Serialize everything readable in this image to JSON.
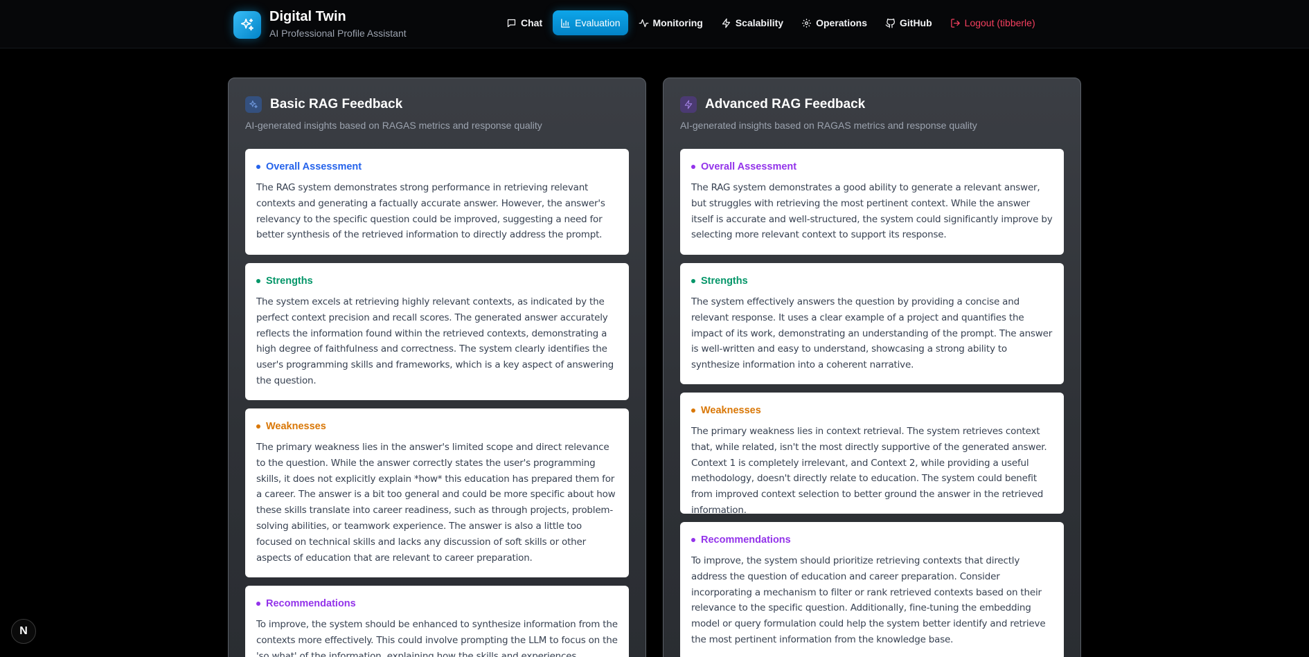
{
  "app": {
    "title": "Digital Twin",
    "subtitle": "AI Professional Profile Assistant"
  },
  "nav": {
    "chat": "Chat",
    "evaluation": "Evaluation",
    "monitoring": "Monitoring",
    "scalability": "Scalability",
    "operations": "Operations",
    "github": "GitHub",
    "logout": "Logout (tibberle)",
    "active": "evaluation"
  },
  "colors": {
    "accent": "#0ea5e9",
    "logout": "#f43f5e",
    "assessment_basic": "#2563eb",
    "assessment_advanced": "#9333ea",
    "strengths": "#059669",
    "weaknesses": "#d97706",
    "recommendations": "#9333ea"
  },
  "basic": {
    "title": "Basic RAG Feedback",
    "subtitle": "AI-generated insights based on RAGAS metrics and response quality",
    "overall": {
      "heading": "Overall Assessment",
      "body": "The RAG system demonstrates strong performance in retrieving relevant contexts and generating a factually accurate answer. However, the answer's relevancy to the specific question could be improved, suggesting a need for better synthesis of the retrieved information to directly address the prompt."
    },
    "strengths": {
      "heading": "Strengths",
      "body": "The system excels at retrieving highly relevant contexts, as indicated by the perfect context precision and recall scores. The generated answer accurately reflects the information found within the retrieved contexts, demonstrating a high degree of faithfulness and correctness. The system clearly identifies the user's programming skills and frameworks, which is a key aspect of answering the question."
    },
    "weaknesses": {
      "heading": "Weaknesses",
      "body": "The primary weakness lies in the answer's limited scope and direct relevance to the question. While the answer correctly states the user's programming skills, it does not explicitly explain *how* this education has prepared them for a career. The answer is a bit too general and could be more specific about how these skills translate into career readiness, such as through projects, problem-solving abilities, or teamwork experience. The answer is also a little too focused on technical skills and lacks any discussion of soft skills or other aspects of education that are relevant to career preparation."
    },
    "recommendations": {
      "heading": "Recommendations",
      "body": "To improve, the system should be enhanced to synthesize information from the contexts more effectively. This could involve prompting the LLM to focus on the 'so what' of the information, explaining how the skills and experiences translate"
    }
  },
  "advanced": {
    "title": "Advanced RAG Feedback",
    "subtitle": "AI-generated insights based on RAGAS metrics and response quality",
    "overall": {
      "heading": "Overall Assessment",
      "body": "The RAG system demonstrates a good ability to generate a relevant answer, but struggles with retrieving the most pertinent context. While the answer itself is accurate and well-structured, the system could significantly improve by selecting more relevant context to support its response."
    },
    "strengths": {
      "heading": "Strengths",
      "body": "The system effectively answers the question by providing a concise and relevant response. It uses a clear example of a project and quantifies the impact of its work, demonstrating an understanding of the prompt. The answer is well-written and easy to understand, showcasing a strong ability to synthesize information into a coherent narrative."
    },
    "weaknesses": {
      "heading": "Weaknesses",
      "body": "The primary weakness lies in context retrieval. The system retrieves context that, while related, isn't the most directly supportive of the generated answer. Context 1 is completely irrelevant, and Context 2, while providing a useful methodology, doesn't directly relate to education. The system could benefit from improved context selection to better ground the answer in the retrieved information."
    },
    "recommendations": {
      "heading": "Recommendations",
      "body": "To improve, the system should prioritize retrieving contexts that directly address the question of education and career preparation. Consider incorporating a mechanism to filter or rank retrieved contexts based on their relevance to the specific question. Additionally, fine-tuning the embedding model or query formulation could help the system better identify and retrieve the most pertinent information from the knowledge base."
    }
  },
  "framework_badge": "N"
}
